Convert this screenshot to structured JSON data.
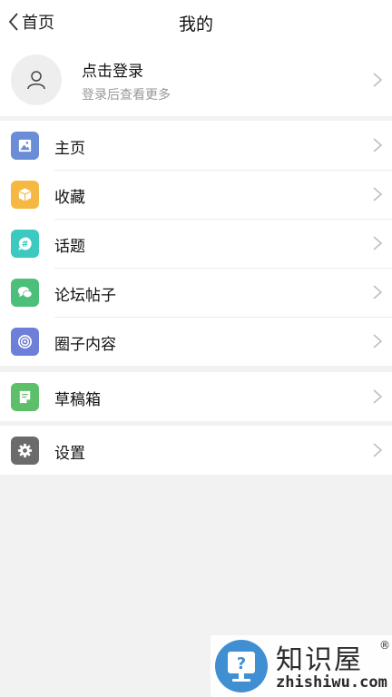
{
  "nav": {
    "back_label": "首页",
    "title": "我的"
  },
  "profile": {
    "title": "点击登录",
    "subtitle": "登录后查看更多"
  },
  "menu_group_1": [
    {
      "label": "主页",
      "icon": "image-icon",
      "color": "#6b8cd6"
    },
    {
      "label": "收藏",
      "icon": "box-icon",
      "color": "#f5b843"
    },
    {
      "label": "话题",
      "icon": "hashtag-icon",
      "color": "#3cc9c0"
    },
    {
      "label": "论坛帖子",
      "icon": "chat-icon",
      "color": "#4cc07a"
    },
    {
      "label": "圈子内容",
      "icon": "circle-icon",
      "color": "#6d7fd8"
    }
  ],
  "menu_group_2": [
    {
      "label": "草稿箱",
      "icon": "draft-icon",
      "color": "#5dbf6a"
    }
  ],
  "menu_group_3": [
    {
      "label": "设置",
      "icon": "gear-icon",
      "color": "#6b6b6b"
    }
  ],
  "watermark": {
    "title": "知识屋",
    "reg": "®",
    "url": "zhishiwu.com"
  }
}
